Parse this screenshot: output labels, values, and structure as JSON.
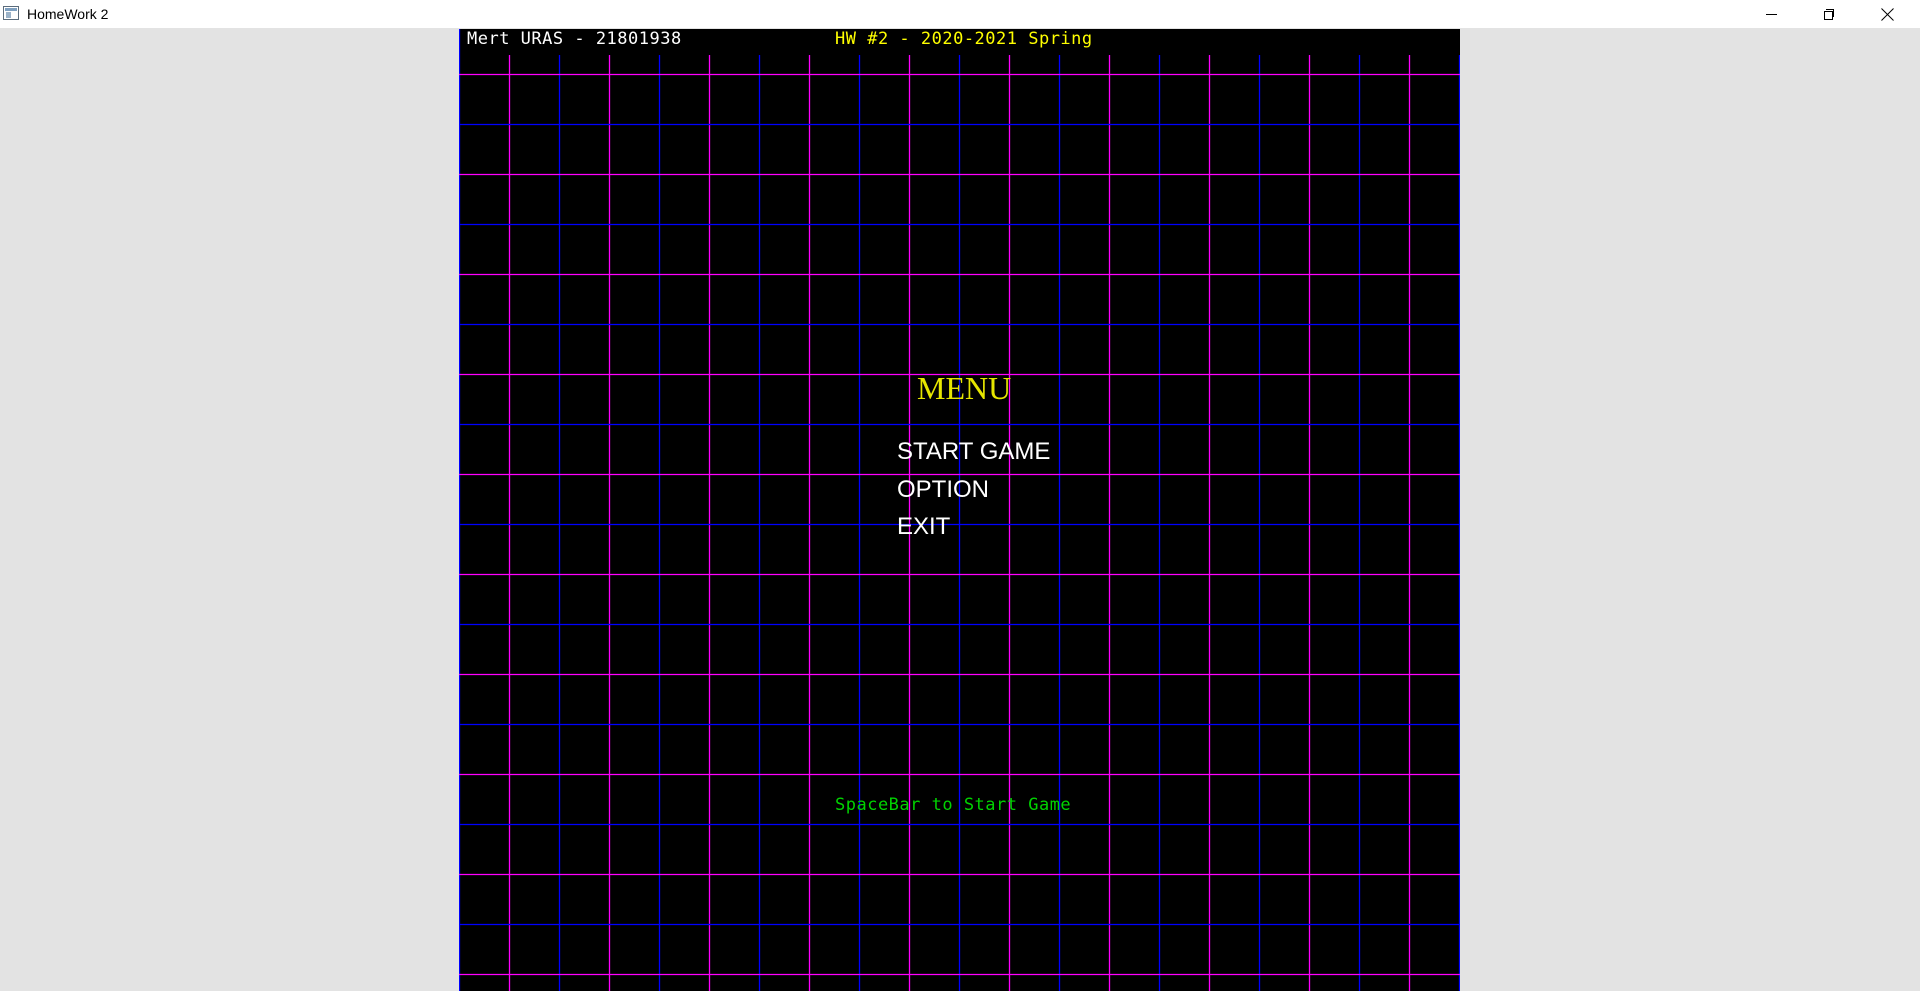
{
  "window": {
    "title": "HomeWork 2",
    "icon": "app-window-icon"
  },
  "hud": {
    "student": "Mert URAS - 21801938",
    "course": "HW #2 - 2020-2021 Spring"
  },
  "menu": {
    "title": "MENU",
    "items": [
      {
        "label": "START GAME"
      },
      {
        "label": "OPTION"
      },
      {
        "label": "EXIT"
      }
    ]
  },
  "hint": "SpaceBar to Start Game",
  "colors": {
    "background": "#000000",
    "grid_major": "#ff00ff",
    "grid_minor": "#0000ff",
    "title": "#ffff00",
    "hint": "#00d200",
    "text": "#ffffff"
  }
}
